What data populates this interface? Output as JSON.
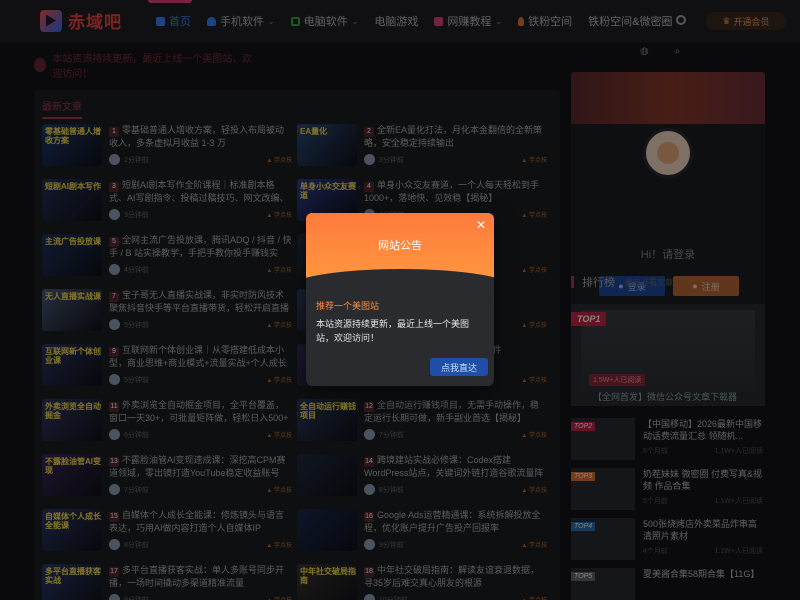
{
  "header": {
    "logo_text": "赤域吧",
    "nav": [
      {
        "label": "首页",
        "color": "#3b82f6"
      },
      {
        "label": "手机软件",
        "color": "#3b82f6"
      },
      {
        "label": "电脑软件",
        "color": "#3aa645"
      },
      {
        "label": "电脑游戏",
        "color": ""
      },
      {
        "label": "网赚教程",
        "color": "#e0457b"
      },
      {
        "label": "铁粉空间",
        "color": "#e07a30"
      },
      {
        "label": "铁粉空间&微密圈",
        "color": ""
      }
    ],
    "vip_label": "开通会员"
  },
  "notice_text": "本站资源持续更新，最近上线一个美图站，欢迎访问！",
  "section_tab": "最新文章",
  "posts": [
    {
      "num": "1",
      "title": "零基础普通人增收方案，轻投入布局被动收入，多条虚拟月收益 1-3 万",
      "time": "2分钟前",
      "tag": "学点技",
      "thumb": "零基础普通人增收方案",
      "bg": "#1e3a70"
    },
    {
      "num": "2",
      "title": "全新EA量化打法，月化本金翻倍的全新策略，安全稳定持续输出",
      "time": "3分钟前",
      "tag": "学点技",
      "thumb": "EA量化",
      "bg": "#2a4a7a"
    },
    {
      "num": "3",
      "title": "短剧AI剧本写作全阶课程｜标准剧本格式、AI写剧指令、投稿过稿技巧、网文改编、主线",
      "time": "3分钟前",
      "tag": "学点技",
      "thumb": "短剧AI剧本写作",
      "bg": "#24305a"
    },
    {
      "num": "4",
      "title": "单身小众交友赛道，一个人每天轻松到手1000+，落地快、见效稳【揭秘】",
      "time": "4分钟前",
      "tag": "学点技",
      "thumb": "单身小众交友赛道",
      "bg": "#2e3f90"
    },
    {
      "num": "5",
      "title": "全网主流广告投放课，腾讯ADQ / 抖音 / 快手 / B 站实操教学，手把手教你投手赚钱实现，全",
      "time": "4分钟前",
      "tag": "学点技",
      "thumb": "主流广告投放课",
      "bg": "#1d3460"
    },
    {
      "num": "6",
      "title": "高效实用策略",
      "time": "4分钟前",
      "tag": "学点技",
      "thumb": "",
      "bg": "#283048"
    },
    {
      "num": "7",
      "title": "宝子哥无人直播实战课，非实时防风技术聚焦抖音快手等平台直播带货，轻松开启直播",
      "time": "5分钟前",
      "tag": "学点技",
      "thumb": "无人直播实战课",
      "bg": "#4a5a7a"
    },
    {
      "num": "8",
      "title": "平台无人电...，全域变现闭",
      "time": "5分钟前",
      "tag": "学点技",
      "thumb": "",
      "bg": "#334066"
    },
    {
      "num": "9",
      "title": "互联网新个体创业课｜从零搭建低成本小型，商业思维+商业模式+流量实战+个人成长全",
      "time": "5分钟前",
      "tag": "学点技",
      "thumb": "互联网新个体创业课",
      "bg": "#2a3560"
    },
    {
      "num": "10",
      "title": "数字人形象克...，案改写、软件",
      "time": "6分钟前",
      "tag": "学点技",
      "thumb": "",
      "bg": "#3a3060"
    },
    {
      "num": "11",
      "title": "外卖浏览全自动掘金项目，全平台覆盖，窗口一天30+，可批量矩阵做，轻松日入500+",
      "time": "6分钟前",
      "tag": "学点技",
      "thumb": "外卖浏览全自动掘金",
      "bg": "#303a66"
    },
    {
      "num": "12",
      "title": "全自动运行赚钱项目，无需手动操作，稳定运行长期可做，新手副业首选【揭秘】",
      "time": "7分钟前",
      "tag": "学点技",
      "thumb": "全自动运行赚钱项目",
      "bg": "#283a5a"
    },
    {
      "num": "13",
      "title": "不露脸油管AI变现速成课：深挖高CPM赛道领域，零出镜打造YouTube稳定收益账号",
      "time": "7分钟前",
      "tag": "学点技",
      "thumb": "不露脸油管AI变现",
      "bg": "#3a2a5a"
    },
    {
      "num": "14",
      "title": "跨境建站实战必修课：Codex搭建WordPress站点，关键词外链打造谷歌流量阵",
      "time": "8分钟前",
      "tag": "学点技",
      "thumb": "",
      "bg": "#1e2a40"
    },
    {
      "num": "15",
      "title": "自媒体个人成长全能课：修炼镜头与语言表达，巧用AI做内容打造个人自媒体IP",
      "time": "8分钟前",
      "tag": "学点技",
      "thumb": "自媒体个人成长全能课",
      "bg": "#2a3a6a"
    },
    {
      "num": "16",
      "title": "Google Ads运营精通课：系统拆解投放全程，优化账户提升广告投产回报率",
      "time": "9分钟前",
      "tag": "学点技",
      "thumb": "",
      "bg": "#1a2a50"
    },
    {
      "num": "17",
      "title": "多平台直播获客实战：单人多账号同步开播，一场时间撬动多渠道精准流量",
      "time": "9分钟前",
      "tag": "学点技",
      "thumb": "多平台直播获客实战",
      "bg": "#2a3a70"
    },
    {
      "num": "18",
      "title": "中年社交破局指南：解读友谊衰退数据，寻35岁后难交真心朋友的根源",
      "time": "10分钟前",
      "tag": "学点技",
      "thumb": "中年社交破局指南",
      "bg": "#3a3630"
    }
  ],
  "sidebar": {
    "greeting": "Hi！请登录",
    "login_label": "登录",
    "register_label": "注册",
    "rank_title": "排行榜",
    "rank_sub": "最热必看文章",
    "top1": {
      "badge": "TOP1",
      "views": "1.5W+人已阅读",
      "title": "【全网首发】微信公众号文章下载器"
    },
    "ranks": [
      {
        "badge": "TOP2",
        "color": "#c0284a",
        "title": "【中国移动】2026最新中国移动话费流量汇总 领随机...",
        "time": "5个月前",
        "views": "1.1W+人已阅读"
      },
      {
        "badge": "TOP3",
        "color": "#d9782c",
        "title": "奶茬妹妹 微密圈 付费写真&视频 作品合集",
        "time": "5个月前",
        "views": "1.1W+人已阅读"
      },
      {
        "badge": "TOP4",
        "color": "#2a6fb0",
        "title": "500张烧烤店外卖菜品炸串高清照片素材",
        "time": "4个月前",
        "views": "1.1W+人已阅读"
      },
      {
        "badge": "TOP5",
        "color": "#666",
        "title": "夏美酱合集58期合集【11G】",
        "time": "",
        "views": ""
      }
    ]
  },
  "modal": {
    "title": "网站公告",
    "subtitle": "推荐一个美图站",
    "body": "本站资源持续更新，最近上线一个美图站，欢迎访问！",
    "button": "点我直达",
    "close": "✕"
  }
}
